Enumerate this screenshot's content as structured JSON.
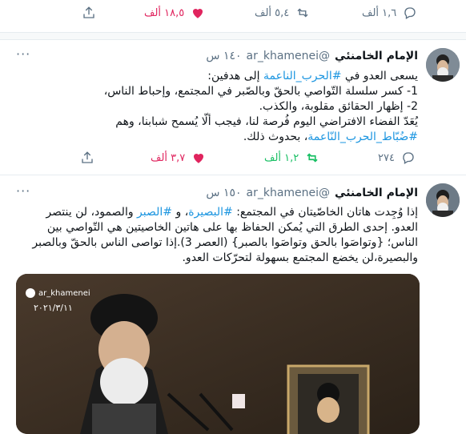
{
  "top_actions": {
    "replies": "١,٦ ألف",
    "retweets": "٥,٤ ألف",
    "likes": "١٨,٥ ألف"
  },
  "tweet1": {
    "name": "الإمام الخامنئي",
    "handle": "@ar_khamenei",
    "time": "١٤٠ س",
    "more": "···",
    "lines": [
      "يسعى العدو في ",
      "#الحرب_الناعمة",
      " إلى هدفين:",
      "1- كسر سلسلة التّواصي بالحقّ وبالصّبر في المجتمع، وإحباط الناس،",
      "2- إظهار الحقائق مقلوبة، والكذب.",
      "يُعَدّ الفضاء الافتراضي اليوم فُرصة لنا، فيجب ألّا يُسمح شبابنا، وهم",
      "#ضُبّاط_الحرب_النّاعمة",
      "، بحدوث ذلك."
    ],
    "replies": "٢٧٤",
    "retweets": "١,٢ ألف",
    "likes": "٣,٧ ألف"
  },
  "tweet2": {
    "name": "الإمام الخامنئي",
    "handle": "@ar_khamenei",
    "time": "١٥٠ س",
    "more": "···",
    "text_a": "إذا وُجِدت هاتان الخاصّيتان في المجتمع: ",
    "tag1": "#البصيرة",
    "text_b": "، و ",
    "tag2": "#الصبر",
    "text_c": " والصمود، لن ينتصر العدو. إحدى الطرق التي يُمكن الحفاظ بها على هاتين الخاصيتين هي التّواصي بين الناس؛ {وتواصَوا بالحق وتواصَوا بالصبر} (العصر 3).إذا تواصى الناس بالحقّ وبالصبر والبصيرة،لن يخضع المجتمع بسهولة لتحرّكات العدو.",
    "media_handle": "ar_khamenei",
    "media_date": "٢٠٢١/٣/١١"
  },
  "colors": {
    "like": "#e0245e",
    "retweet": "#17bf63",
    "link": "#1b95e0"
  }
}
